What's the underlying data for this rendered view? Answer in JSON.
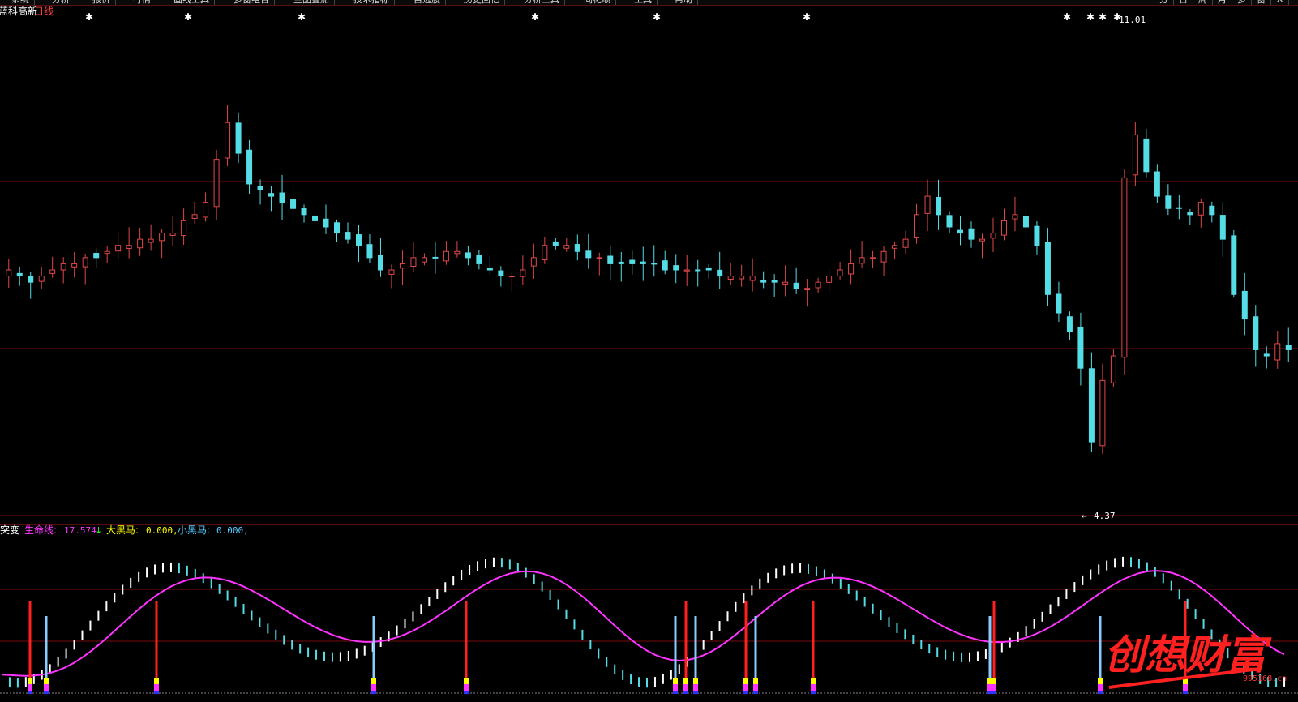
{
  "window": {
    "menu_items": [
      "系统",
      "分析",
      "报价",
      "行情",
      "画线工具",
      "多窗组合",
      "主图叠加",
      "技术指标",
      "自选股",
      "历史回忆",
      "分析工具",
      "同花顺",
      "工具",
      "帮助"
    ],
    "right_controls": [
      "分",
      "日",
      "周",
      "月",
      "多",
      "窗",
      "✕"
    ]
  },
  "main_panel": {
    "stock_name": "蓝科高新",
    "period": "日线",
    "high_label": "11.01",
    "low_label": "4.37",
    "colors": {
      "up": "#e04848",
      "down": "#55dde6",
      "grid": "#7a0c0c",
      "text": "#ffffff"
    }
  },
  "indicator_panel": {
    "name": "突变",
    "lines": [
      {
        "label": "生命线:",
        "value": "17.574",
        "arrow": "↓",
        "color": "#ff33ff"
      },
      {
        "label": "大黑马:",
        "value": "0.000,",
        "color": "#ffff00"
      },
      {
        "label": "小黑马:",
        "value": "0.000,",
        "color": "#55ccff"
      }
    ]
  },
  "watermark": {
    "text": "创想财富",
    "url": "995168.cn",
    "color": "#ff2020"
  },
  "chart_data": {
    "type": "candlestick",
    "title": "",
    "price_range": [
      3.4,
      11.4
    ],
    "extremes": {
      "high": 11.01,
      "low": 4.37
    },
    "closes": [
      7.4,
      7.3,
      7.2,
      7.3,
      7.4,
      7.5,
      7.5,
      7.6,
      7.6,
      7.7,
      7.8,
      7.8,
      7.9,
      7.9,
      8.0,
      8.0,
      8.2,
      8.3,
      8.5,
      9.2,
      9.8,
      9.3,
      8.8,
      8.7,
      8.6,
      8.5,
      8.4,
      8.3,
      8.2,
      8.1,
      8.0,
      7.9,
      7.8,
      7.6,
      7.4,
      7.4,
      7.5,
      7.6,
      7.6,
      7.6,
      7.7,
      7.7,
      7.6,
      7.5,
      7.4,
      7.3,
      7.3,
      7.4,
      7.6,
      7.8,
      7.8,
      7.8,
      7.7,
      7.6,
      7.6,
      7.5,
      7.5,
      7.5,
      7.5,
      7.5,
      7.4,
      7.4,
      7.4,
      7.4,
      7.4,
      7.3,
      7.3,
      7.3,
      7.3,
      7.2,
      7.2,
      7.2,
      7.1,
      7.1,
      7.2,
      7.3,
      7.4,
      7.5,
      7.6,
      7.6,
      7.7,
      7.8,
      7.9,
      8.3,
      8.6,
      8.3,
      8.1,
      8.0,
      7.9,
      7.9,
      8.0,
      8.2,
      8.3,
      8.1,
      7.8,
      7.0,
      6.7,
      6.4,
      5.8,
      4.6,
      5.6,
      6.0,
      8.9,
      9.6,
      9.0,
      8.6,
      8.4,
      8.4,
      8.3,
      8.5,
      8.3,
      7.9,
      7.0,
      6.6,
      6.1,
      6.0,
      6.2,
      6.1
    ],
    "indicator": {
      "life_line_last": 17.574,
      "big_horse": 0.0,
      "small_horse": 0.0
    }
  }
}
